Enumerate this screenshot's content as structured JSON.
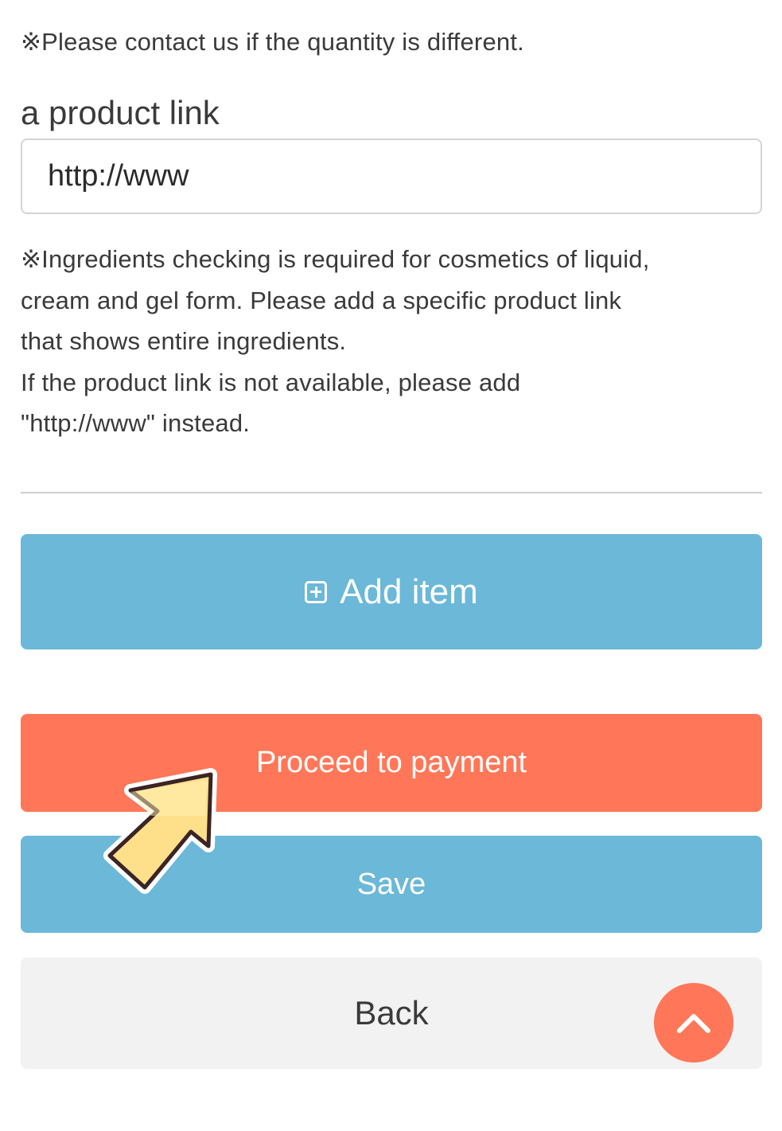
{
  "notes": {
    "quantity": "※Please contact us if the quantity is different.",
    "ingredients_lines": [
      "※Ingredients checking is required for cosmetics of liquid,",
      "cream and gel form. Please add a specific product link",
      "that shows entire ingredients.",
      "If the product link is not available, please add",
      "\"http://www\" instead."
    ]
  },
  "product_link": {
    "label": "a product link",
    "value": "http://www"
  },
  "buttons": {
    "add_item": "Add item",
    "proceed": "Proceed to payment",
    "save": "Save",
    "back": "Back"
  },
  "icons": {
    "add": "plus-square-icon",
    "scroll_top": "chevron-up-icon",
    "pointer": "pointing-arrow-icon"
  },
  "colors": {
    "primary_blue": "#6bb8d8",
    "accent_orange": "#ff7758",
    "back_gray": "#f2f2f2",
    "arrow_yellow": "#ffe08a"
  }
}
